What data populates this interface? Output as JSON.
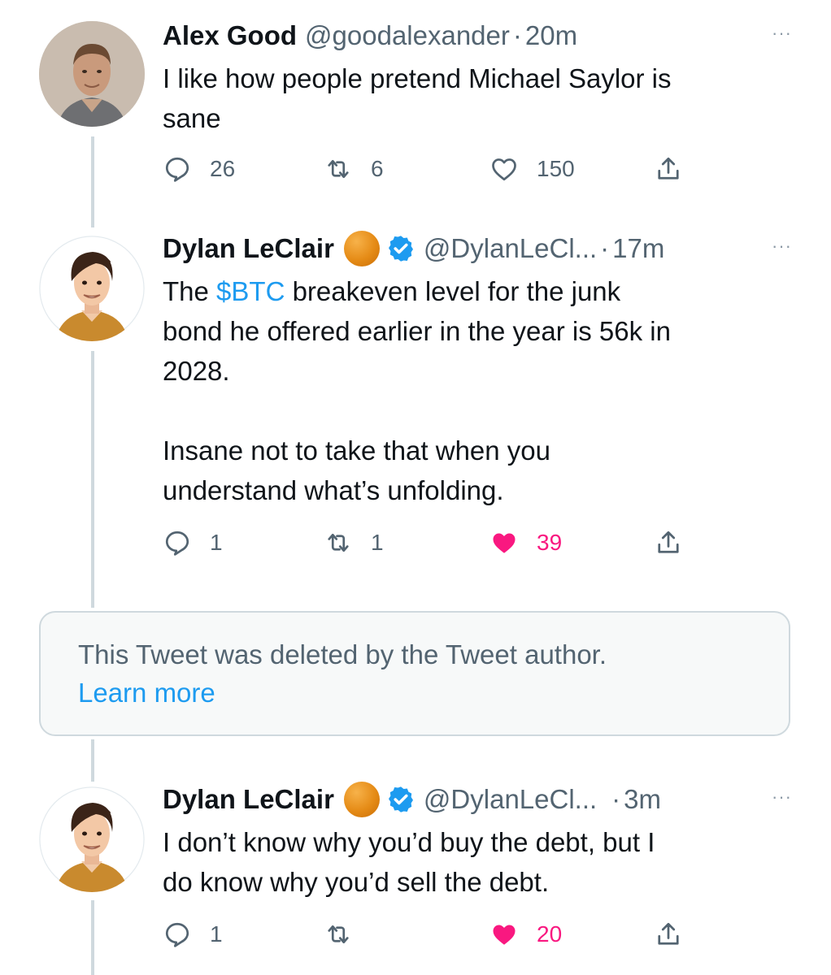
{
  "tweets": [
    {
      "name": "Alex Good",
      "handle": "@goodalexander",
      "dot": "·",
      "time": "20m",
      "text": "I like how people pretend Michael Saylor is\nsane",
      "replies": "26",
      "retweets": "6",
      "likes": "150",
      "liked": false
    },
    {
      "name": "Dylan LeClair",
      "handle": "@DylanLeCl...",
      "dot": "·",
      "time": "17m",
      "text_before_cashtag": "The ",
      "cashtag": "$BTC",
      "text_after_cashtag": " breakeven level for the junk\nbond he offered earlier in the year is 56k in\n2028.\n\nInsane not to take that when you\nunderstand what’s unfolding.",
      "replies": "1",
      "retweets": "1",
      "likes": "39",
      "liked": true
    },
    {
      "name": "Dylan LeClair",
      "handle": "@DylanLeCl...",
      "dot": "·",
      "time": "3m",
      "text": "I don’t know why you’d buy the debt, but I\ndo know why you’d sell the debt.",
      "replies": "1",
      "retweets": "",
      "likes": "20",
      "liked": true
    }
  ],
  "deleted_notice": {
    "text": "This Tweet was deleted by the Tweet author.",
    "link": "Learn more"
  },
  "more_icon": "···",
  "colors": {
    "accent": "#1d9bf0",
    "like": "#f91880",
    "secondary_text": "#536471",
    "thread_line": "#cfd9de"
  },
  "icons": {
    "reply": "reply-icon",
    "retweet": "retweet-icon",
    "like": "heart-icon",
    "share": "share-icon",
    "verified": "verified-badge-icon",
    "emoji": "orange-circle-emoji-icon",
    "more": "more-options-icon"
  }
}
